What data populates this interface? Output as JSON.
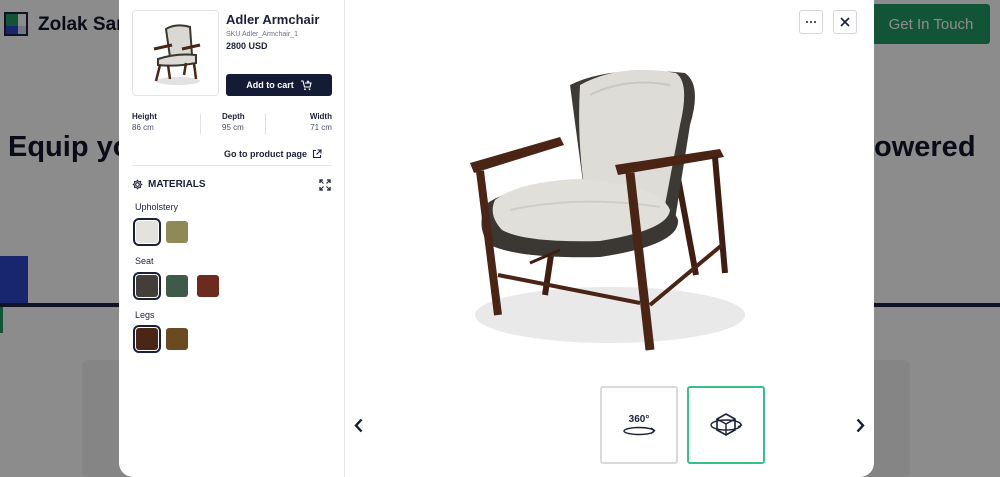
{
  "background": {
    "brand": "Zolak Sar",
    "cta": "Get In Touch",
    "hero_left": "Equip yo",
    "hero_right": "owered"
  },
  "product": {
    "name": "Adler Armchair",
    "sku": "SKU Adler_Armchair_1",
    "price": "2800 USD",
    "add_to_cart": "Add to cart",
    "goto_page": "Go to product page"
  },
  "dimensions": [
    {
      "label": "Height",
      "value": "86 cm"
    },
    {
      "label": "Depth",
      "value": "95 cm"
    },
    {
      "label": "Width",
      "value": "71 cm"
    }
  ],
  "materials": {
    "title": "MATERIALS",
    "groups": [
      {
        "label": "Upholstery",
        "swatches": [
          "#e4e2dc",
          "#8f8a55"
        ],
        "selected": 0
      },
      {
        "label": "Seat",
        "swatches": [
          "#433e38",
          "#3e5a48",
          "#6d2a1f"
        ],
        "selected": 0
      },
      {
        "label": "Legs",
        "swatches": [
          "#4a2616",
          "#6b4a22"
        ],
        "selected": 0
      }
    ]
  },
  "viewer": {
    "mode_360_label": "360°",
    "active_mode": "3d"
  },
  "colors": {
    "accent_green": "#35c08a",
    "dark_navy": "#141b35",
    "cta_green": "#1f9a63"
  }
}
